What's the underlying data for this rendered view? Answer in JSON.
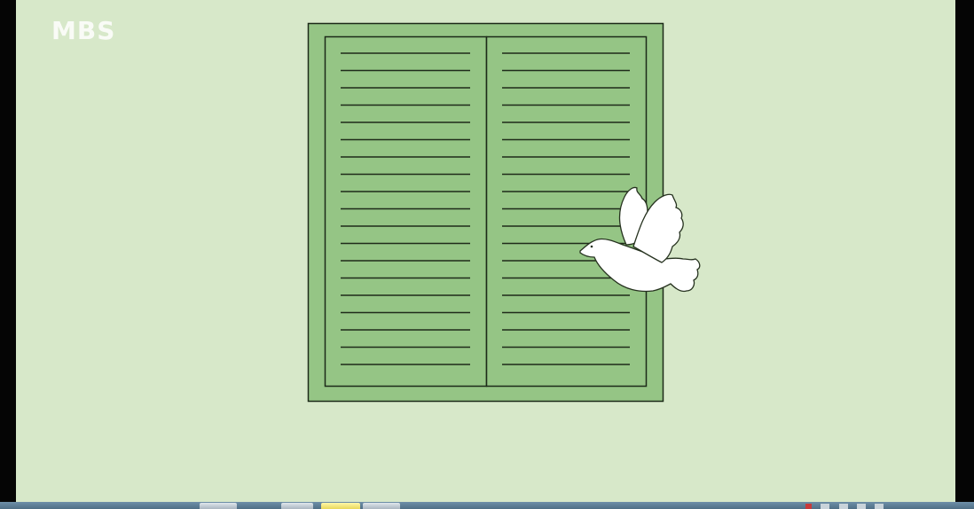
{
  "logo": {
    "text": "MBS",
    "color": "#ffffff"
  },
  "scene": {
    "background_color": "#d7e8c9",
    "shutter_color": "#95c585",
    "shutter_outline_color": "#1c2a18",
    "slat_color": "#1f2b1a",
    "dove_color": "#ffffff"
  },
  "taskbar": {
    "buttons": [
      {
        "name": "taskbar-button-1",
        "active": false
      },
      {
        "name": "taskbar-button-2",
        "active": false
      },
      {
        "name": "taskbar-button-3",
        "active": true
      },
      {
        "name": "taskbar-button-4",
        "active": false
      }
    ],
    "tray_icons": [
      "tray-icon-red",
      "tray-icon",
      "tray-icon",
      "tray-icon",
      "tray-icon"
    ],
    "clock": ""
  }
}
